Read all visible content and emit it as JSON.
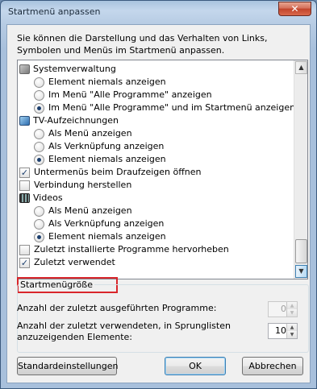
{
  "window": {
    "title": "Startmenü anpassen",
    "close_glyph": "✕"
  },
  "intro_text": "Sie können die Darstellung und das Verhalten von Links, Symbolen und Menüs im Startmenü anpassen.",
  "list": {
    "items": [
      {
        "kind": "category",
        "icon": "admin-tools-icon",
        "label": "Systemverwaltung"
      },
      {
        "kind": "radio",
        "checked": false,
        "label": "Element niemals anzeigen"
      },
      {
        "kind": "radio",
        "checked": false,
        "label": "Im Menü \"Alle Programme\" anzeigen"
      },
      {
        "kind": "radio",
        "checked": true,
        "label": "Im Menü \"Alle Programme\" und im Startmenü anzeigen"
      },
      {
        "kind": "category",
        "icon": "tv-icon",
        "label": "TV-Aufzeichnungen"
      },
      {
        "kind": "radio",
        "checked": false,
        "label": "Als Menü anzeigen"
      },
      {
        "kind": "radio",
        "checked": false,
        "label": "Als Verknüpfung anzeigen"
      },
      {
        "kind": "radio",
        "checked": true,
        "label": "Element niemals anzeigen"
      },
      {
        "kind": "checkbox",
        "checked": true,
        "label": "Untermenüs beim Draufzeigen öffnen"
      },
      {
        "kind": "checkbox",
        "checked": false,
        "label": "Verbindung herstellen"
      },
      {
        "kind": "category",
        "icon": "video-icon",
        "label": "Videos"
      },
      {
        "kind": "radio",
        "checked": false,
        "label": "Als Menü anzeigen"
      },
      {
        "kind": "radio",
        "checked": false,
        "label": "Als Verknüpfung anzeigen"
      },
      {
        "kind": "radio",
        "checked": true,
        "label": "Element niemals anzeigen"
      },
      {
        "kind": "checkbox",
        "checked": false,
        "label": "Zuletzt installierte Programme hervorheben"
      },
      {
        "kind": "checkbox",
        "checked": true,
        "label": "Zuletzt verwendet"
      }
    ],
    "check_glyph": "✓",
    "scroll_up_glyph": "▲",
    "scroll_down_glyph": "▼"
  },
  "startmenu_size": {
    "group_title": "Startmenügröße",
    "recent_programs_label": "Anzahl der zuletzt ausgeführten Programme:",
    "recent_programs_value": "0",
    "jumplist_label_line1": "Anzahl der zuletzt verwendeten, in Sprunglisten",
    "jumplist_label_line2": "anzuzeigenden Elemente:",
    "jumplist_value": "10",
    "spin_up_glyph": "▲",
    "spin_down_glyph": "▼"
  },
  "buttons": {
    "defaults": "Standardeinstellungen",
    "ok": "OK",
    "cancel": "Abbrechen"
  },
  "colors": {
    "highlight_border": "#d9262b",
    "radio_dot": "#1c3f6e"
  }
}
